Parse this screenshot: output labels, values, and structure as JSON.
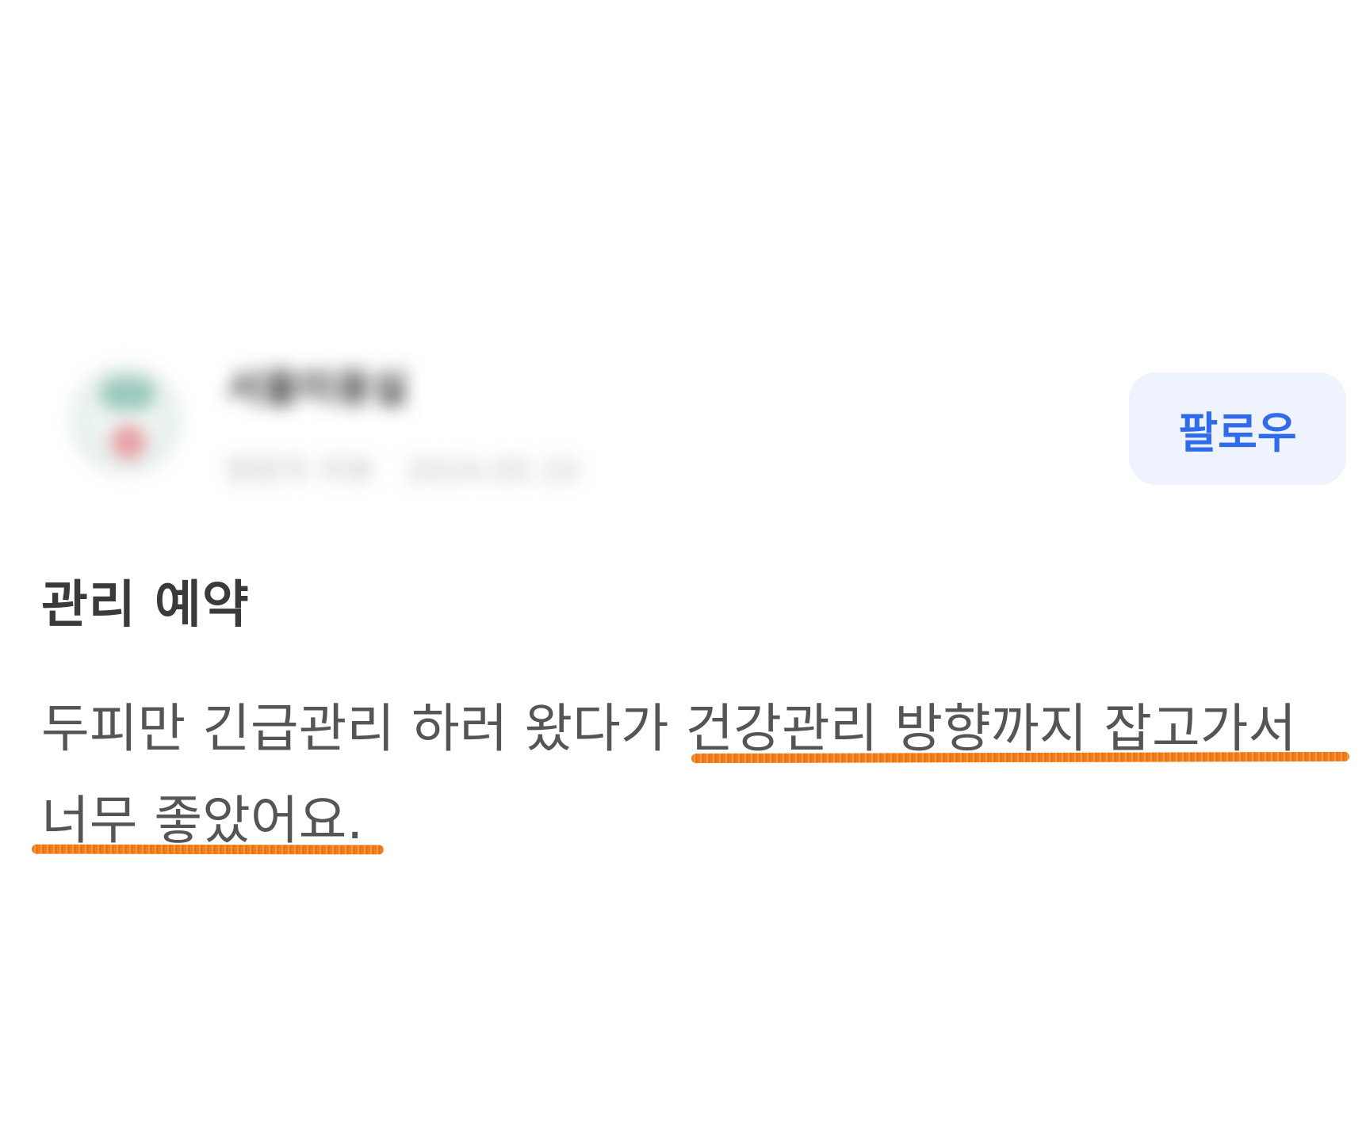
{
  "profile": {
    "name": "서울미용실",
    "meta": [
      "방문자 리뷰",
      "2024.05.10"
    ]
  },
  "follow_label": "팔로우",
  "review": {
    "title": "관리 예약",
    "body_lines": [
      "두피만 긴급관리 하러 왔다가 건강관리 방향까지 잡고가서",
      "너무 좋았어요."
    ],
    "highlight_color": "#f07d1e"
  },
  "colors": {
    "accent": "#2f6bea",
    "button_bg": "#eef3fd",
    "title_text": "#3a3a3a",
    "body_text": "#555555"
  }
}
